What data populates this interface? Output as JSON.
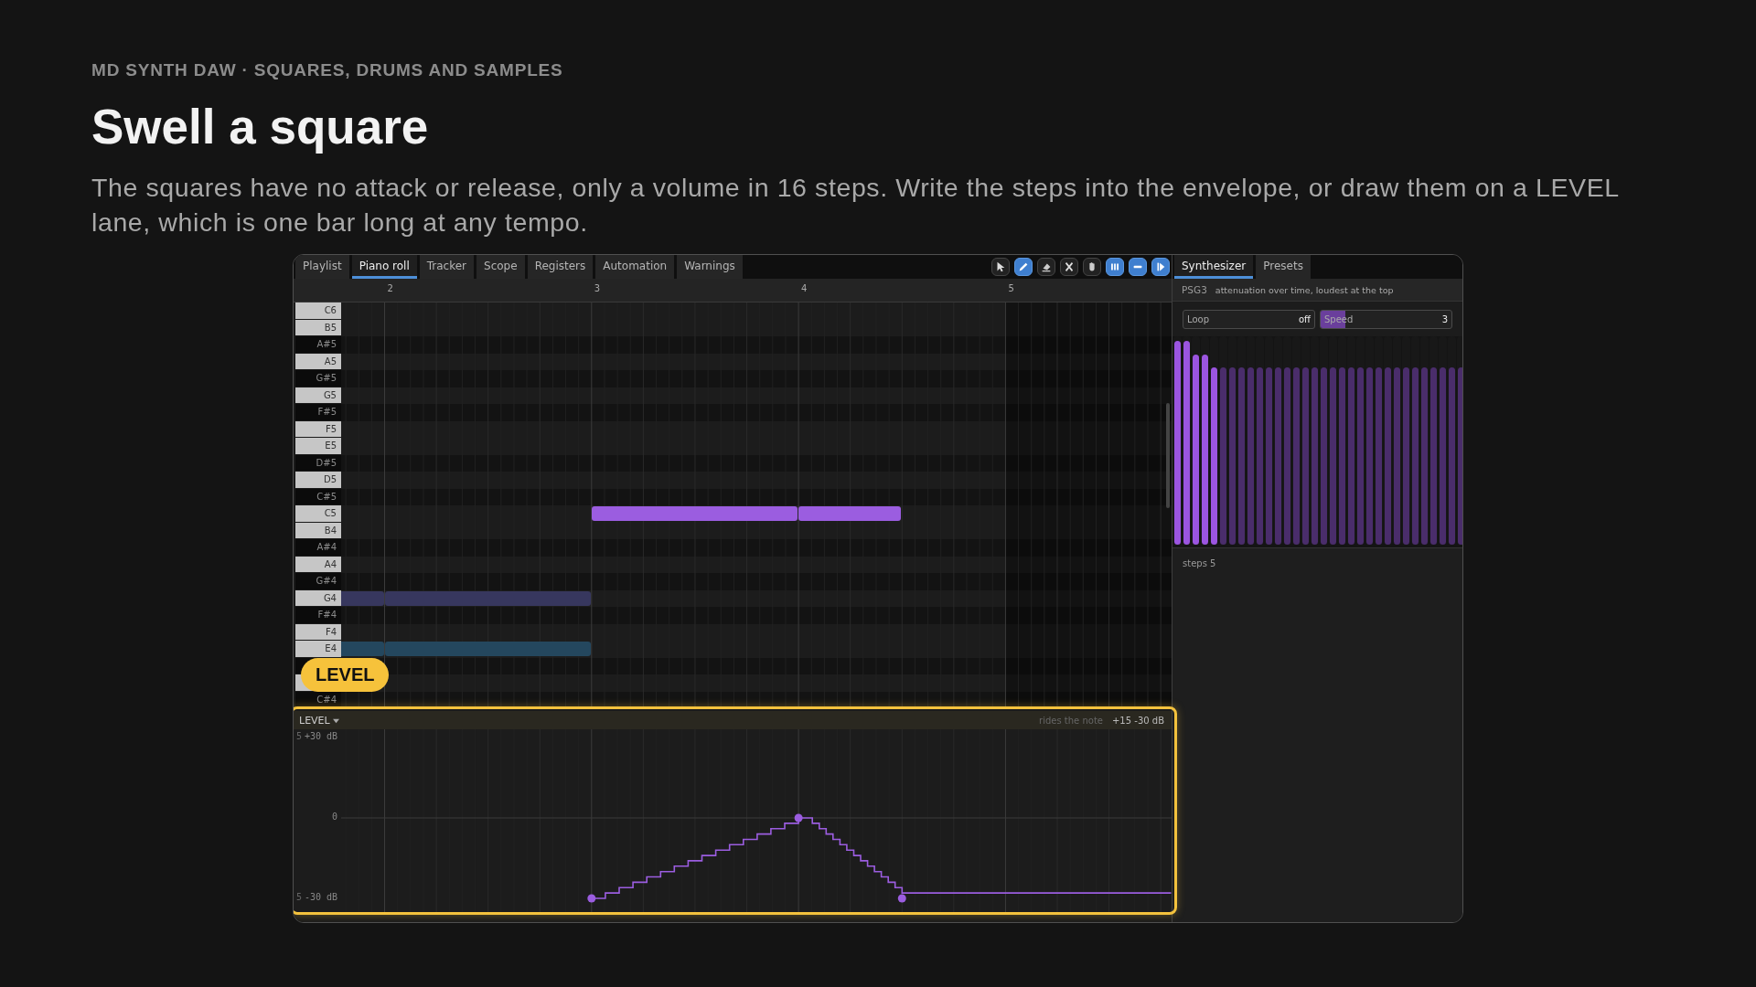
{
  "header": {
    "eyebrow": "MD SYNTH DAW · SQUARES, DRUMS AND SAMPLES",
    "title": "Swell a square",
    "text": "The squares have no attack or release, only a volume in 16 steps. Write the steps into the envelope, or draw them on a LEVEL lane, which is one bar long at any tempo."
  },
  "editor": {
    "tabs": [
      {
        "label": "Playlist",
        "selected": false
      },
      {
        "label": "Piano roll",
        "selected": true
      },
      {
        "label": "Tracker",
        "selected": false
      },
      {
        "label": "Scope",
        "selected": false
      },
      {
        "label": "Registers",
        "selected": false
      },
      {
        "label": "Automation",
        "selected": false
      },
      {
        "label": "Warnings",
        "selected": false
      }
    ],
    "tools": [
      {
        "kind": "pointer",
        "on": false
      },
      {
        "kind": "pencil",
        "on": true
      },
      {
        "kind": "eraser",
        "on": false
      },
      {
        "kind": "cut",
        "on": false
      },
      {
        "kind": "hand",
        "on": false
      },
      {
        "kind": "columns",
        "on": true
      },
      {
        "kind": "minus",
        "on": true
      },
      {
        "kind": "step",
        "on": true
      }
    ],
    "ruler": [
      "2",
      "3",
      "4",
      "5"
    ],
    "keys": [
      {
        "label": "C6",
        "black": false
      },
      {
        "label": "B5",
        "black": false
      },
      {
        "label": "A#5",
        "black": true
      },
      {
        "label": "A5",
        "black": false
      },
      {
        "label": "G#5",
        "black": true
      },
      {
        "label": "G5",
        "black": false
      },
      {
        "label": "F#5",
        "black": true
      },
      {
        "label": "F5",
        "black": false
      },
      {
        "label": "E5",
        "black": false
      },
      {
        "label": "D#5",
        "black": true
      },
      {
        "label": "D5",
        "black": false
      },
      {
        "label": "C#5",
        "black": true
      },
      {
        "label": "C5",
        "black": false,
        "notes": [
          {
            "color": "#9b5de0"
          },
          {
            "color": "#9b5de0"
          }
        ]
      },
      {
        "label": "B4",
        "black": false
      },
      {
        "label": "A#4",
        "black": true
      },
      {
        "label": "A4",
        "black": false
      },
      {
        "label": "G#4",
        "black": true
      },
      {
        "label": "G4",
        "black": false,
        "notes": [
          {
            "color": "#37375e"
          },
          {
            "color": "#37375e"
          }
        ]
      },
      {
        "label": "F#4",
        "black": true
      },
      {
        "label": "F4",
        "black": false
      },
      {
        "label": "E4",
        "black": false,
        "notes": [
          {
            "color": "#24475e"
          },
          {
            "color": "#24475e"
          }
        ]
      },
      {
        "black": true
      },
      {
        "black": false
      },
      {
        "label": "C#4",
        "black": true
      }
    ],
    "badge": "LEVEL",
    "lane": {
      "name": "LEVEL",
      "hint": "rides the note",
      "range": "+15  -30 dB",
      "edge_marks": [
        "5",
        "5"
      ],
      "scale": [
        "+30 dB",
        "0",
        "-30 dB"
      ]
    }
  },
  "synth": {
    "tabs": [
      {
        "label": "Synthesizer",
        "selected": true
      },
      {
        "label": "Presets",
        "selected": false
      }
    ],
    "channel": "PSG3",
    "description": "attenuation over time, loudest at the top",
    "loop": {
      "label": "Loop",
      "value": "off"
    },
    "speed": {
      "label": "Speed",
      "value": "3",
      "level": 0.19
    },
    "envelope": [
      {
        "level": 1,
        "active": true
      },
      {
        "level": 1,
        "active": true
      },
      {
        "level": 0.935,
        "active": true
      },
      {
        "level": 0.935,
        "active": true
      },
      {
        "level": 0.87,
        "active": true
      },
      {
        "level": 0.87,
        "active": false
      },
      {
        "level": 0.87,
        "active": false
      },
      {
        "level": 0.87,
        "active": false
      },
      {
        "level": 0.87,
        "active": false
      },
      {
        "level": 0.87,
        "active": false
      },
      {
        "level": 0.87,
        "active": false
      },
      {
        "level": 0.87,
        "active": false
      },
      {
        "level": 0.87,
        "active": false
      },
      {
        "level": 0.87,
        "active": false
      },
      {
        "level": 0.87,
        "active": false
      },
      {
        "level": 0.87,
        "active": false
      },
      {
        "level": 0.87,
        "active": false
      },
      {
        "level": 0.87,
        "active": false
      },
      {
        "level": 0.87,
        "active": false
      },
      {
        "level": 0.87,
        "active": false
      },
      {
        "level": 0.87,
        "active": false
      },
      {
        "level": 0.87,
        "active": false
      },
      {
        "level": 0.87,
        "active": false
      },
      {
        "level": 0.87,
        "active": false
      },
      {
        "level": 0.87,
        "active": false
      },
      {
        "level": 0.87,
        "active": false
      },
      {
        "level": 0.87,
        "active": false
      },
      {
        "level": 0.87,
        "active": false
      },
      {
        "level": 0.87,
        "active": false
      },
      {
        "level": 0.87,
        "active": false
      },
      {
        "level": 0.87,
        "active": false
      },
      {
        "level": 0.87,
        "active": false
      }
    ],
    "steps": "steps 5"
  }
}
